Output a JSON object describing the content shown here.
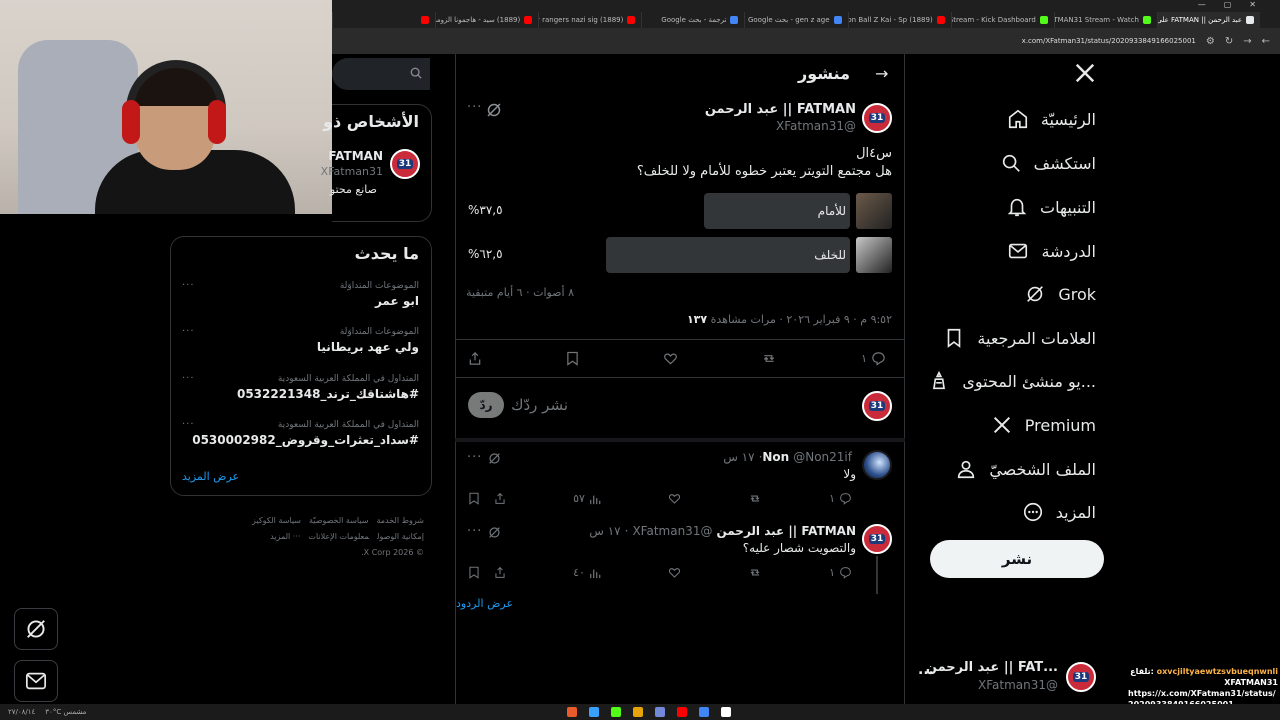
{
  "browser": {
    "tabs": [
      {
        "title": "عبد الرحمن || FATMAN على X",
        "color": "#e7e9ea",
        "active": true
      },
      {
        "title": "XFATMAN31 Stream - Watch",
        "color": "#53fc18"
      },
      {
        "title": "Stream - Kick Dashboard",
        "color": "#53fc18"
      },
      {
        "title": "(1889) Dragon Ball Z Kai - Sp",
        "color": "#ff0000"
      },
      {
        "title": "gen z age - بحث Google",
        "color": "#4285f4"
      },
      {
        "title": "ترجمة - بحث Google",
        "color": "#4285f4"
      },
      {
        "title": "(1889) power rangers nazi sig",
        "color": "#ff0000"
      },
      {
        "title": "(1889) سيد - هاجمونا الزومبي",
        "color": "#ff0000"
      },
      {
        "title": "",
        "color": "#ff0000"
      }
    ],
    "url": "x.com/XFatman31/status/2020933849166025001"
  },
  "nav": {
    "items": [
      {
        "label": "الرئيسيّة",
        "icon": "home-icon"
      },
      {
        "label": "استكشف",
        "icon": "search-icon"
      },
      {
        "label": "التنبيهات",
        "icon": "bell-icon"
      },
      {
        "label": "الدردشة",
        "icon": "mail-icon"
      },
      {
        "label": "Grok",
        "icon": "grok-icon"
      },
      {
        "label": "العلامات المرجعية",
        "icon": "bookmark-icon"
      },
      {
        "label": "...يو منشئ المحتوى",
        "icon": "creator-icon"
      },
      {
        "label": "Premium",
        "icon": "x-premium-icon"
      },
      {
        "label": "الملف الشخصيّ",
        "icon": "profile-icon"
      },
      {
        "label": "المزيد",
        "icon": "more-icon"
      }
    ],
    "post_button": "نشر",
    "account": {
      "name": "...FAT || عبد الرحمن",
      "handle": "@XFatman31",
      "more": "..."
    }
  },
  "header": {
    "title": "منشور",
    "back": "→"
  },
  "post": {
    "author": "FATMAN || عبد الرحمن",
    "handle": "@XFatman31",
    "avatar_text": "31",
    "line1": "س٤ال",
    "line2": "هل مجتمع التويتر يعتبر خطوه للأمام ولا للخلف؟",
    "poll": [
      {
        "label": "للأمام",
        "percent_text": "٣٧,٥%",
        "percent": 37.5
      },
      {
        "label": "للخلف",
        "percent_text": "٦٢,٥%",
        "percent": 62.5
      }
    ],
    "poll_meta": "٨ أصوات · ٦ أيام متبقية",
    "timestamp": "٩:٥٢ م · ٩ فبراير ٢٠٢٦ ·",
    "views_count": "١٣٧",
    "views_label": "مرات مشاهدة",
    "replies": "١",
    "reply_placeholder": "نشر ردّك",
    "reply_button": "ردّ"
  },
  "replies": [
    {
      "author": "Non",
      "handle": "@Non21if",
      "time": "١٧ س",
      "text": "ولا",
      "replies": "١",
      "views": "٥٧"
    },
    {
      "author": "FATMAN || عبد الرحمن",
      "handle": "@XFatman31",
      "time": "١٧ س",
      "text": "والتصويت شصار عليه؟",
      "replies": "١",
      "views": "٤٠"
    }
  ],
  "show_replies": "عرض الردود",
  "sidebar": {
    "people_title": "الأشخاص ذو",
    "person_name": "FATMAN",
    "person_handle": "XFatman31",
    "person_bio": "صانع محتو",
    "trends_title": "ما يحدث",
    "trends": [
      {
        "context": "الموضوعات المتداوَلة",
        "name": "ابو عمر"
      },
      {
        "context": "الموضوعات المتداوَلة",
        "name": "ولي عهد بريطانيا"
      },
      {
        "context": "المتداول في المملكة العربية السعودية",
        "name": "#هاشتاقك_ترند_0532221348"
      },
      {
        "context": "المتداول في المملكة العربية السعودية",
        "name": "#سداد_تعثرات_وقروض_0530002982"
      }
    ],
    "show_more": "عرض المزيد",
    "footer": [
      "شروط الخدمة",
      "سياسة الخصوصيّة",
      "سياسة الكوكيز",
      "إمكانية الوصول",
      "معلومات الإعلانات",
      "··· المزيد",
      "© 2026 X Corp."
    ]
  },
  "chat": {
    "user": "oxvcjiltyaewtzsvbueqnwnli",
    "prefix": ":تلقاع",
    "user2": "XFATMAN31",
    "link": "https://x.com/XFatman31/status/2020933849166025001"
  },
  "taskbar": {
    "weather": "٣٠°C مشمس",
    "date": "٢٧/٠٨/١٤"
  }
}
